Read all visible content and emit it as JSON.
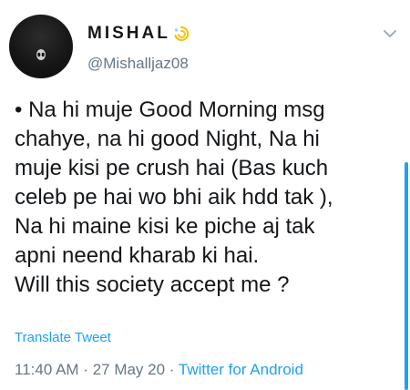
{
  "tweet": {
    "display_name": "MISHAL",
    "name_emoji": "dizzy-symbol",
    "handle": "@Mishalljaz08",
    "text": "• Na hi muje Good Morning msg\nchahye, na hi good Night, Na hi\nmuje kisi pe crush hai (Bas kuch\nceleb pe hai wo bhi aik hdd tak ),\nNa hi maine kisi ke piche aj tak\napni neend kharab ki hai.\nWill this society accept me ?",
    "translate_label": "Translate Tweet",
    "time": "11:40 AM",
    "separator": " · ",
    "date": "27 May 20",
    "source": "Twitter for Android"
  },
  "colors": {
    "accent": "#1da1f2",
    "secondary_text": "#657786",
    "primary_text": "#14171a"
  },
  "icons": {
    "menu": "chevron-down-icon",
    "avatar_emblem": "alien-icon"
  }
}
